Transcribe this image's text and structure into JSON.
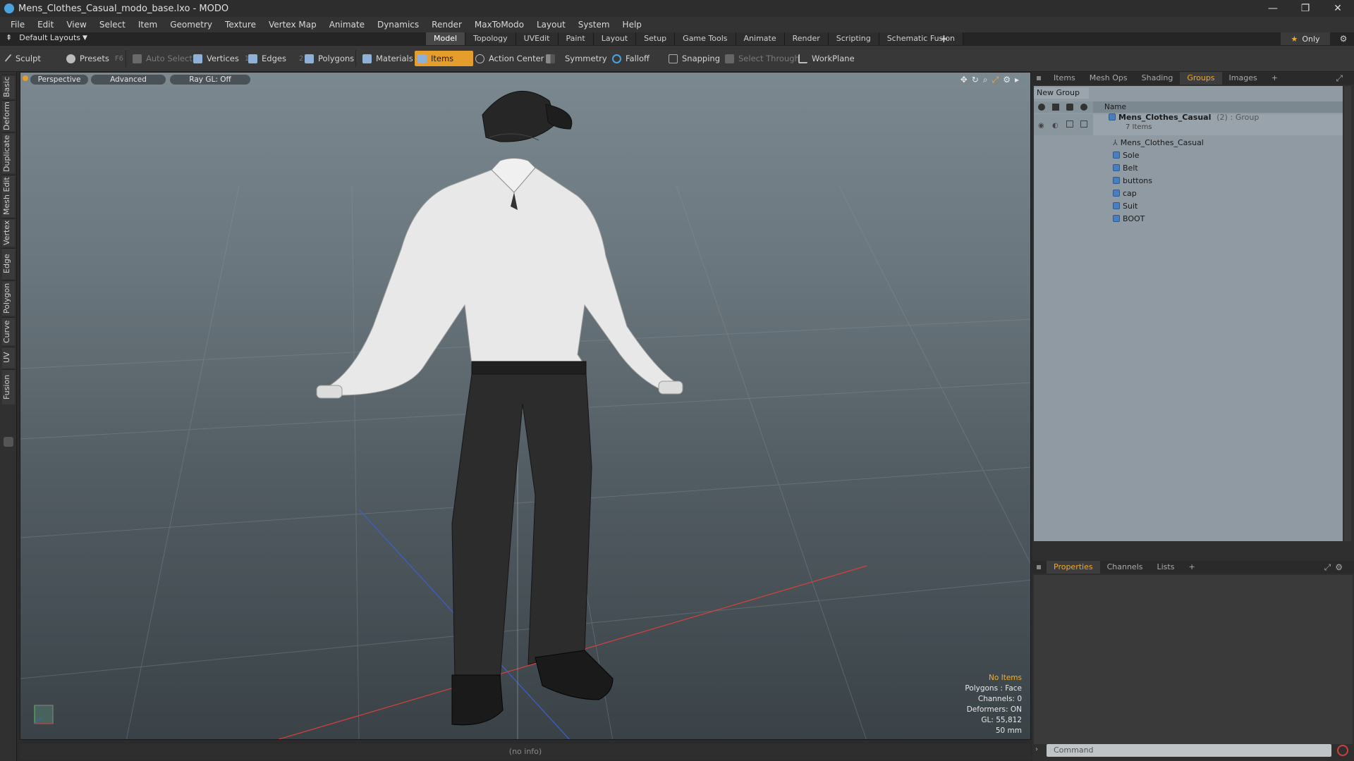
{
  "window": {
    "title": "Mens_Clothes_Casual_modo_base.lxo - MODO",
    "controls": [
      "—",
      "❐",
      "✕"
    ]
  },
  "menu": [
    "File",
    "Edit",
    "View",
    "Select",
    "Item",
    "Geometry",
    "Texture",
    "Vertex Map",
    "Animate",
    "Dynamics",
    "Render",
    "MaxToModo",
    "Layout",
    "System",
    "Help"
  ],
  "layout_bar": {
    "layout_label": "Default Layouts",
    "tabs": [
      "Model",
      "Topology",
      "UVEdit",
      "Paint",
      "Layout",
      "Setup",
      "Game Tools",
      "Animate",
      "Render",
      "Scripting",
      "Schematic Fusion"
    ],
    "active_tab": "Model",
    "plus": "+",
    "only_label": "Only"
  },
  "toolbar": {
    "sculpt": "Sculpt",
    "presets": "Presets",
    "presets_hotkey": "F6",
    "auto_select": "Auto Select",
    "vertices": "Vertices",
    "vertices_hotkey": "1",
    "edges": "Edges",
    "edges_hotkey": "2",
    "polygons": "Polygons",
    "materials": "Materials",
    "items": "Items",
    "action_center": "Action Center",
    "symmetry": "Symmetry",
    "falloff": "Falloff",
    "snapping": "Snapping",
    "select_through": "Select Through",
    "workplane": "WorkPlane"
  },
  "left_tabs": [
    "Basic",
    "Deform",
    "Duplicate",
    "Mesh Edit",
    "Vertex",
    "Edge",
    "Polygon",
    "Curve",
    "UV",
    "Fusion"
  ],
  "viewport": {
    "view_mode": "Perspective",
    "shading": "Advanced",
    "raygl": "Ray GL: Off",
    "stats": {
      "items": "No Items",
      "polygons": "Polygons : Face",
      "channels": "Channels: 0",
      "deformers": "Deformers: ON",
      "gl": "GL: 55,812",
      "scale": "50 mm"
    }
  },
  "status": "(no info)",
  "right_panel": {
    "tabs": [
      "Items",
      "Mesh Ops",
      "Shading",
      "Groups",
      "Images"
    ],
    "active_tab": "Groups",
    "new_group": "New Group",
    "column_name": "Name",
    "group": {
      "name": "Mens_Clothes_Casual",
      "count": "(2)",
      "type": ": Group",
      "subtitle": "7 Items"
    },
    "items": [
      "Mens_Clothes_Casual",
      "Sole",
      "Belt",
      "buttons",
      "cap",
      "Suit",
      "BOOT"
    ],
    "props_tabs": [
      "Properties",
      "Channels",
      "Lists"
    ],
    "props_active": "Properties",
    "command_placeholder": "Command"
  },
  "colors": {
    "accent": "#e59d2c",
    "viewport_top": "#7b8890",
    "viewport_bottom": "#3a4247",
    "x_axis": "#d8403c",
    "z_axis": "#3d5fd0"
  }
}
